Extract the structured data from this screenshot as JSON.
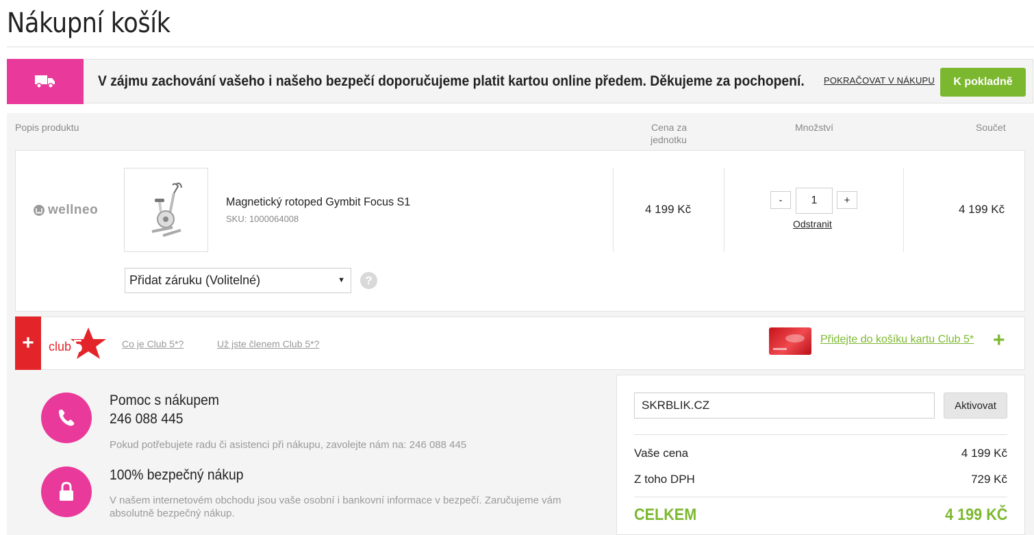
{
  "page": {
    "title": "Nákupní košík"
  },
  "notice": {
    "text": "V zájmu zachování vašeho i našeho bezpečí doporučujeme platit kartou online předem. Děkujeme za pochopení.",
    "continue_label": "POKRAČOVAT V NÁKUPU",
    "checkout_label": "K pokladně",
    "icon": "truck-icon"
  },
  "table": {
    "headers": {
      "description": "Popis produktu",
      "unit_price_line1": "Cena za",
      "unit_price_line2": "jednotku",
      "quantity": "Množství",
      "total": "Součet"
    }
  },
  "item": {
    "brand": "wellneo",
    "name": "Magnetický rotoped Gymbit Focus S1",
    "sku": "SKU: 1000064008",
    "unit_price": "4 199 Kč",
    "quantity": "1",
    "minus": "-",
    "plus": "+",
    "remove_label": "Odstranit",
    "total": "4 199 Kč",
    "warranty_selected": "Přidat záruku (Volitelné)",
    "help": "?"
  },
  "club": {
    "logo_text": "club",
    "logo_num": "5",
    "plus": "+",
    "link1": "Co je Club 5*?",
    "link2": "Už jste členem Club 5*?",
    "cta": "Přidejte do košíku kartu Club 5*",
    "cta_plus": "+"
  },
  "help": {
    "phone_title": "Pomoc s nákupem",
    "phone_number": "246 088 445",
    "phone_desc": "Pokud potřebujete radu či asistenci při nákupu, zavolejte nám na: 246 088 445",
    "secure_title": "100% bezpečný nákup",
    "secure_desc": "V našem internetovém obchodu jsou vaše osobní i bankovní informace v bezpečí. Zaručujeme vám absolutně bezpečný nákup."
  },
  "summary": {
    "coupon_value": "SKRBLIK.CZ",
    "activate_label": "Aktivovat",
    "price_label": "Vaše cena",
    "price_value": "4 199 Kč",
    "vat_label": "Z toho DPH",
    "vat_value": "729 Kč",
    "total_label": "CELKEM",
    "total_value": "4 199 KČ"
  },
  "colors": {
    "pink": "#e9399a",
    "green": "#7cb82f",
    "red": "#e3252a"
  }
}
